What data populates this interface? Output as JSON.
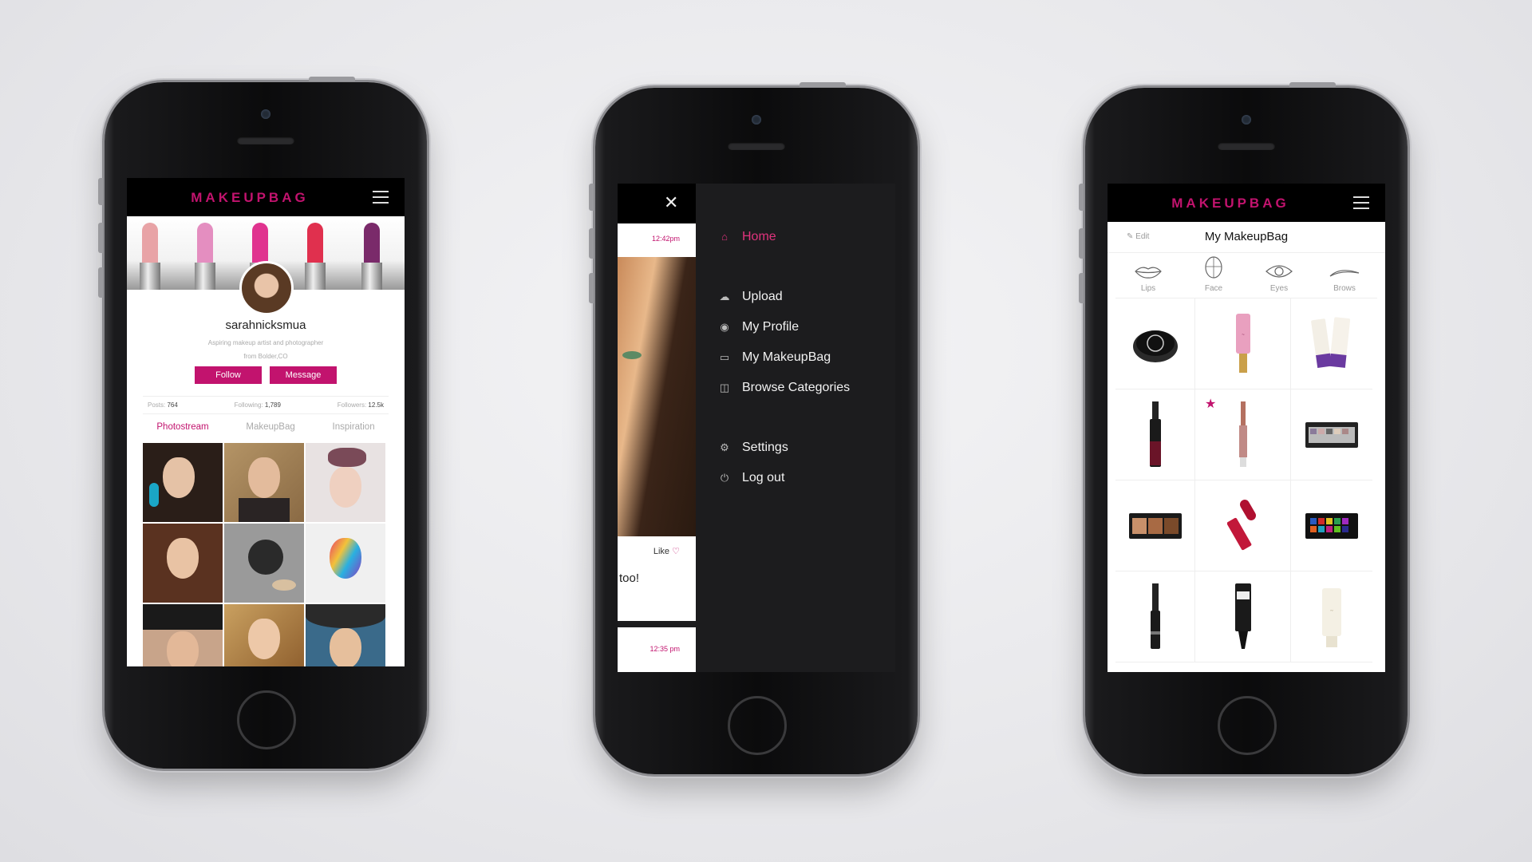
{
  "brand": {
    "logo": "MAKEUPBAG",
    "accent": "#c2136e"
  },
  "profile_screen": {
    "username": "sarahnicksmua",
    "bio": "Aspiring makeup artist and photographer",
    "location": "from Bolder,CO",
    "follow_label": "Follow",
    "message_label": "Message",
    "stats": {
      "posts_label": "Posts:",
      "posts": "764",
      "following_label": "Following:",
      "following": "1,789",
      "followers_label": "Followers:",
      "followers": "12.5k"
    },
    "tabs": [
      "Photostream",
      "MakeupBag",
      "Inspiration"
    ],
    "lipstick_colors": [
      "#e8a3a6",
      "#e48ec0",
      "#e0338f",
      "#e0304e",
      "#7a2a6a"
    ]
  },
  "menu_screen": {
    "close_icon": "close-icon",
    "time_1": "12:42pm",
    "like_label": "Like",
    "comment_fragment": "too!",
    "time_2": "12:35 pm",
    "items": [
      {
        "label": "Home",
        "icon": "home-icon"
      },
      {
        "label": "Upload",
        "icon": "cloud-upload-icon"
      },
      {
        "label": "My Profile",
        "icon": "user-circle-icon"
      },
      {
        "label": "My MakeupBag",
        "icon": "bag-icon"
      },
      {
        "label": "Browse Categories",
        "icon": "book-icon"
      },
      {
        "label": "Settings",
        "icon": "gear-icon"
      },
      {
        "label": "Log out",
        "icon": "power-icon"
      }
    ]
  },
  "bag_screen": {
    "edit_label": "Edit",
    "title": "My MakeupBag",
    "categories": [
      "Lips",
      "Face",
      "Eyes",
      "Brows"
    ]
  }
}
